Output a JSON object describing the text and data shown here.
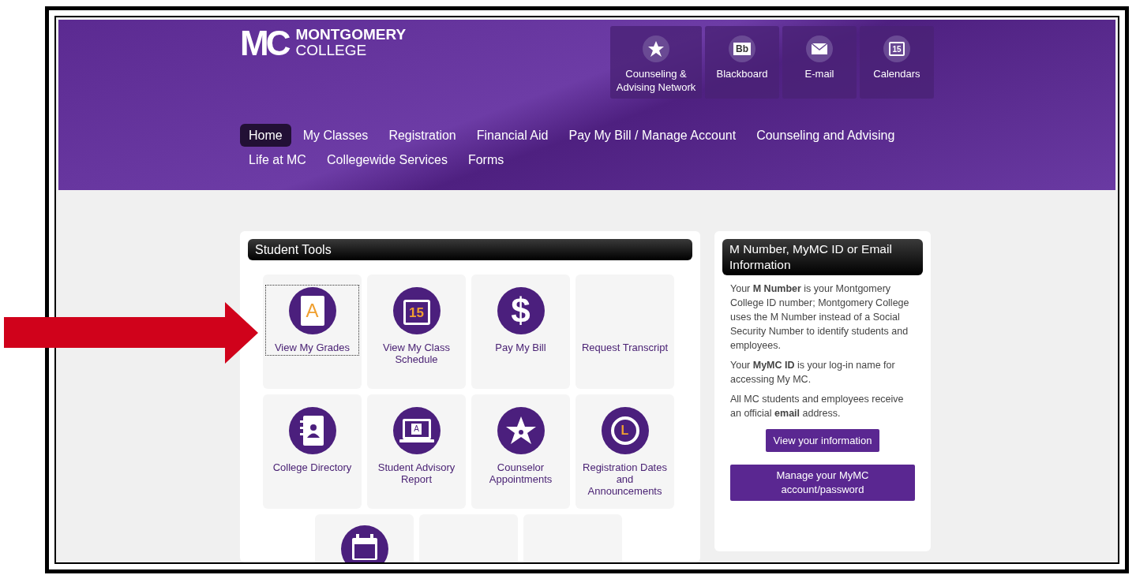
{
  "logo": {
    "mark": "MC",
    "name_line_1": "MONTGOMERY",
    "name_line_2": "COLLEGE"
  },
  "quick_links": [
    {
      "kind": "star",
      "label": "Counseling & Advising Network"
    },
    {
      "kind": "bb",
      "icon_text": "Bb",
      "label": "Blackboard"
    },
    {
      "kind": "mail",
      "label": "E-mail"
    },
    {
      "kind": "calendar",
      "icon_text": "15",
      "label": "Calendars"
    }
  ],
  "nav": [
    {
      "label": "Home",
      "selected": true
    },
    {
      "label": "My Classes",
      "selected": false
    },
    {
      "label": "Registration",
      "selected": false
    },
    {
      "label": "Financial Aid",
      "selected": false
    },
    {
      "label": "Pay My Bill / Manage Account",
      "selected": false
    },
    {
      "label": "Counseling and Advising",
      "selected": false
    },
    {
      "label": "Life at MC",
      "selected": false
    },
    {
      "label": "Collegewide Services",
      "selected": false
    },
    {
      "label": "Forms",
      "selected": false
    }
  ],
  "student_tools": {
    "title": "Student Tools",
    "tiles": [
      {
        "kind": "grades",
        "icon_text": "A",
        "label": "View My Grades",
        "focused": true
      },
      {
        "kind": "schedule",
        "icon_text": "15",
        "label": "View My Class Schedule",
        "focused": false
      },
      {
        "kind": "dollar",
        "icon_text": "$",
        "label": "Pay My Bill",
        "focused": false
      },
      {
        "kind": "none",
        "label": "Request Transcript",
        "focused": false
      },
      {
        "kind": "directory",
        "label": "College Directory",
        "focused": false
      },
      {
        "kind": "laptop",
        "icon_text": "A",
        "label": "Student Advisory Report",
        "focused": false
      },
      {
        "kind": "star",
        "label": "Counselor Appointments",
        "focused": false
      },
      {
        "kind": "alarm",
        "icon_text": "L",
        "label": "Registration Dates and Announcements",
        "focused": false
      }
    ],
    "bottom_tiles": [
      {
        "kind": "calendar"
      },
      {
        "kind": "none"
      },
      {
        "kind": "none"
      }
    ]
  },
  "info": {
    "title": "M Number, MyMC ID or Email Information",
    "paragraphs": [
      "Your **M Number** is your Montgomery College ID number; Montgomery College uses the M Number instead of a Social Security Number to identify students and employees.",
      "Your **MyMC ID** is your log-in name for accessing My MC.",
      "All MC students and employees receive an official **email** address."
    ],
    "buttons": [
      "View your information",
      "Manage your MyMC account/password"
    ]
  }
}
